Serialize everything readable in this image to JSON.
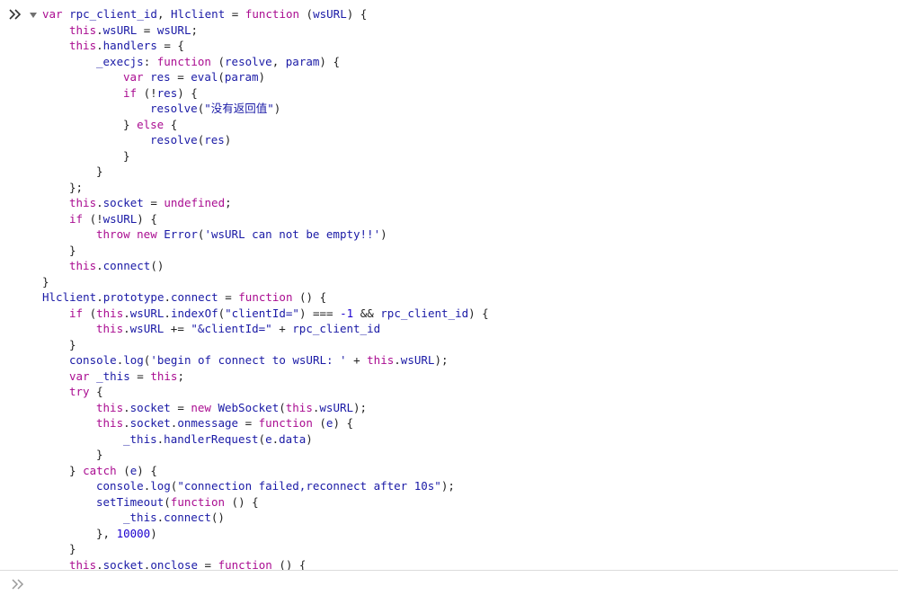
{
  "entry": {
    "lines": [
      [
        1,
        [
          [
            "k",
            "var "
          ],
          [
            "v",
            "rpc_client_id"
          ],
          [
            "p",
            ", "
          ],
          [
            "v",
            "Hlclient"
          ],
          [
            "p",
            " = "
          ],
          [
            "k",
            "function"
          ],
          [
            "p",
            " ("
          ],
          [
            "v",
            "wsURL"
          ],
          [
            "p",
            ") {"
          ]
        ]
      ],
      [
        2,
        [
          [
            "k",
            "this"
          ],
          [
            "p",
            "."
          ],
          [
            "v",
            "wsURL"
          ],
          [
            "p",
            " = "
          ],
          [
            "v",
            "wsURL"
          ],
          [
            "p",
            ";"
          ]
        ]
      ],
      [
        2,
        [
          [
            "k",
            "this"
          ],
          [
            "p",
            "."
          ],
          [
            "v",
            "handlers"
          ],
          [
            "p",
            " = {"
          ]
        ]
      ],
      [
        3,
        [
          [
            "v",
            "_execjs"
          ],
          [
            "p",
            ": "
          ],
          [
            "k",
            "function"
          ],
          [
            "p",
            " ("
          ],
          [
            "v",
            "resolve"
          ],
          [
            "p",
            ", "
          ],
          [
            "v",
            "param"
          ],
          [
            "p",
            ") {"
          ]
        ]
      ],
      [
        4,
        [
          [
            "k",
            "var "
          ],
          [
            "v",
            "res"
          ],
          [
            "p",
            " = "
          ],
          [
            "v",
            "eval"
          ],
          [
            "p",
            "("
          ],
          [
            "v",
            "param"
          ],
          [
            "p",
            ")"
          ]
        ]
      ],
      [
        4,
        [
          [
            "k",
            "if"
          ],
          [
            "p",
            " (!"
          ],
          [
            "v",
            "res"
          ],
          [
            "p",
            ") {"
          ]
        ]
      ],
      [
        5,
        [
          [
            "v",
            "resolve"
          ],
          [
            "p",
            "("
          ],
          [
            "s",
            "\"没有返回值\""
          ],
          [
            "p",
            ")"
          ]
        ]
      ],
      [
        4,
        [
          [
            "p",
            "} "
          ],
          [
            "k",
            "else"
          ],
          [
            "p",
            " {"
          ]
        ]
      ],
      [
        5,
        [
          [
            "v",
            "resolve"
          ],
          [
            "p",
            "("
          ],
          [
            "v",
            "res"
          ],
          [
            "p",
            ")"
          ]
        ]
      ],
      [
        4,
        [
          [
            "p",
            "}"
          ]
        ]
      ],
      [
        3,
        [
          [
            "p",
            "}"
          ]
        ]
      ],
      [
        2,
        [
          [
            "p",
            "};"
          ]
        ]
      ],
      [
        2,
        [
          [
            "k",
            "this"
          ],
          [
            "p",
            "."
          ],
          [
            "v",
            "socket"
          ],
          [
            "p",
            " = "
          ],
          [
            "k",
            "undefined"
          ],
          [
            "p",
            ";"
          ]
        ]
      ],
      [
        2,
        [
          [
            "k",
            "if"
          ],
          [
            "p",
            " (!"
          ],
          [
            "v",
            "wsURL"
          ],
          [
            "p",
            ") {"
          ]
        ]
      ],
      [
        3,
        [
          [
            "k",
            "throw new "
          ],
          [
            "v",
            "Error"
          ],
          [
            "p",
            "("
          ],
          [
            "s",
            "'wsURL can not be empty!!'"
          ],
          [
            "p",
            ")"
          ]
        ]
      ],
      [
        2,
        [
          [
            "p",
            "}"
          ]
        ]
      ],
      [
        2,
        [
          [
            "k",
            "this"
          ],
          [
            "p",
            "."
          ],
          [
            "v",
            "connect"
          ],
          [
            "p",
            "()"
          ]
        ]
      ],
      [
        1,
        [
          [
            "p",
            "}"
          ]
        ]
      ],
      [
        1,
        [
          [
            "v",
            "Hlclient"
          ],
          [
            "p",
            "."
          ],
          [
            "v",
            "prototype"
          ],
          [
            "p",
            "."
          ],
          [
            "v",
            "connect"
          ],
          [
            "p",
            " = "
          ],
          [
            "k",
            "function"
          ],
          [
            "p",
            " () {"
          ]
        ]
      ],
      [
        2,
        [
          [
            "k",
            "if"
          ],
          [
            "p",
            " ("
          ],
          [
            "k",
            "this"
          ],
          [
            "p",
            "."
          ],
          [
            "v",
            "wsURL"
          ],
          [
            "p",
            "."
          ],
          [
            "v",
            "indexOf"
          ],
          [
            "p",
            "("
          ],
          [
            "s",
            "\"clientId=\""
          ],
          [
            "p",
            ") === "
          ],
          [
            "n",
            "-1"
          ],
          [
            "p",
            " && "
          ],
          [
            "v",
            "rpc_client_id"
          ],
          [
            "p",
            ") {"
          ]
        ]
      ],
      [
        3,
        [
          [
            "k",
            "this"
          ],
          [
            "p",
            "."
          ],
          [
            "v",
            "wsURL"
          ],
          [
            "p",
            " += "
          ],
          [
            "s",
            "\"&clientId=\""
          ],
          [
            "p",
            " + "
          ],
          [
            "v",
            "rpc_client_id"
          ]
        ]
      ],
      [
        2,
        [
          [
            "p",
            "}"
          ]
        ]
      ],
      [
        2,
        [
          [
            "v",
            "console"
          ],
          [
            "p",
            "."
          ],
          [
            "v",
            "log"
          ],
          [
            "p",
            "("
          ],
          [
            "s",
            "'begin of connect to wsURL: '"
          ],
          [
            "p",
            " + "
          ],
          [
            "k",
            "this"
          ],
          [
            "p",
            "."
          ],
          [
            "v",
            "wsURL"
          ],
          [
            "p",
            ");"
          ]
        ]
      ],
      [
        2,
        [
          [
            "k",
            "var "
          ],
          [
            "v",
            "_this"
          ],
          [
            "p",
            " = "
          ],
          [
            "k",
            "this"
          ],
          [
            "p",
            ";"
          ]
        ]
      ],
      [
        2,
        [
          [
            "k",
            "try"
          ],
          [
            "p",
            " {"
          ]
        ]
      ],
      [
        3,
        [
          [
            "k",
            "this"
          ],
          [
            "p",
            "."
          ],
          [
            "v",
            "socket"
          ],
          [
            "p",
            " = "
          ],
          [
            "k",
            "new "
          ],
          [
            "v",
            "WebSocket"
          ],
          [
            "p",
            "("
          ],
          [
            "k",
            "this"
          ],
          [
            "p",
            "."
          ],
          [
            "v",
            "wsURL"
          ],
          [
            "p",
            ");"
          ]
        ]
      ],
      [
        3,
        [
          [
            "k",
            "this"
          ],
          [
            "p",
            "."
          ],
          [
            "v",
            "socket"
          ],
          [
            "p",
            "."
          ],
          [
            "v",
            "onmessage"
          ],
          [
            "p",
            " = "
          ],
          [
            "k",
            "function"
          ],
          [
            "p",
            " ("
          ],
          [
            "v",
            "e"
          ],
          [
            "p",
            ") {"
          ]
        ]
      ],
      [
        4,
        [
          [
            "v",
            "_this"
          ],
          [
            "p",
            "."
          ],
          [
            "v",
            "handlerRequest"
          ],
          [
            "p",
            "("
          ],
          [
            "v",
            "e"
          ],
          [
            "p",
            "."
          ],
          [
            "v",
            "data"
          ],
          [
            "p",
            ")"
          ]
        ]
      ],
      [
        3,
        [
          [
            "p",
            "}"
          ]
        ]
      ],
      [
        2,
        [
          [
            "p",
            "} "
          ],
          [
            "k",
            "catch"
          ],
          [
            "p",
            " ("
          ],
          [
            "v",
            "e"
          ],
          [
            "p",
            ") {"
          ]
        ]
      ],
      [
        3,
        [
          [
            "v",
            "console"
          ],
          [
            "p",
            "."
          ],
          [
            "v",
            "log"
          ],
          [
            "p",
            "("
          ],
          [
            "s",
            "\"connection failed,reconnect after 10s\""
          ],
          [
            "p",
            ");"
          ]
        ]
      ],
      [
        3,
        [
          [
            "v",
            "setTimeout"
          ],
          [
            "p",
            "("
          ],
          [
            "k",
            "function"
          ],
          [
            "p",
            " () {"
          ]
        ]
      ],
      [
        4,
        [
          [
            "v",
            "_this"
          ],
          [
            "p",
            "."
          ],
          [
            "v",
            "connect"
          ],
          [
            "p",
            "()"
          ]
        ]
      ],
      [
        3,
        [
          [
            "p",
            "}, "
          ],
          [
            "n",
            "10000"
          ],
          [
            "p",
            ")"
          ]
        ]
      ],
      [
        2,
        [
          [
            "p",
            "}"
          ]
        ]
      ],
      [
        2,
        [
          [
            "k",
            "this"
          ],
          [
            "p",
            "."
          ],
          [
            "v",
            "socket"
          ],
          [
            "p",
            "."
          ],
          [
            "v",
            "onclose"
          ],
          [
            "p",
            " = "
          ],
          [
            "k",
            "function"
          ],
          [
            "p",
            " () {"
          ]
        ]
      ]
    ]
  },
  "icons": {
    "entry_prompt": "chevron-double-right-icon",
    "expand": "triangle-down-icon",
    "input_prompt": "chevron-double-right-icon"
  },
  "colors": {
    "keyword": "#aa0d91",
    "identifier": "#1a1aa6",
    "number": "#1c00cf",
    "punctuation": "#222222",
    "prompt": "#333333",
    "input_prompt": "#9a9a9a"
  }
}
